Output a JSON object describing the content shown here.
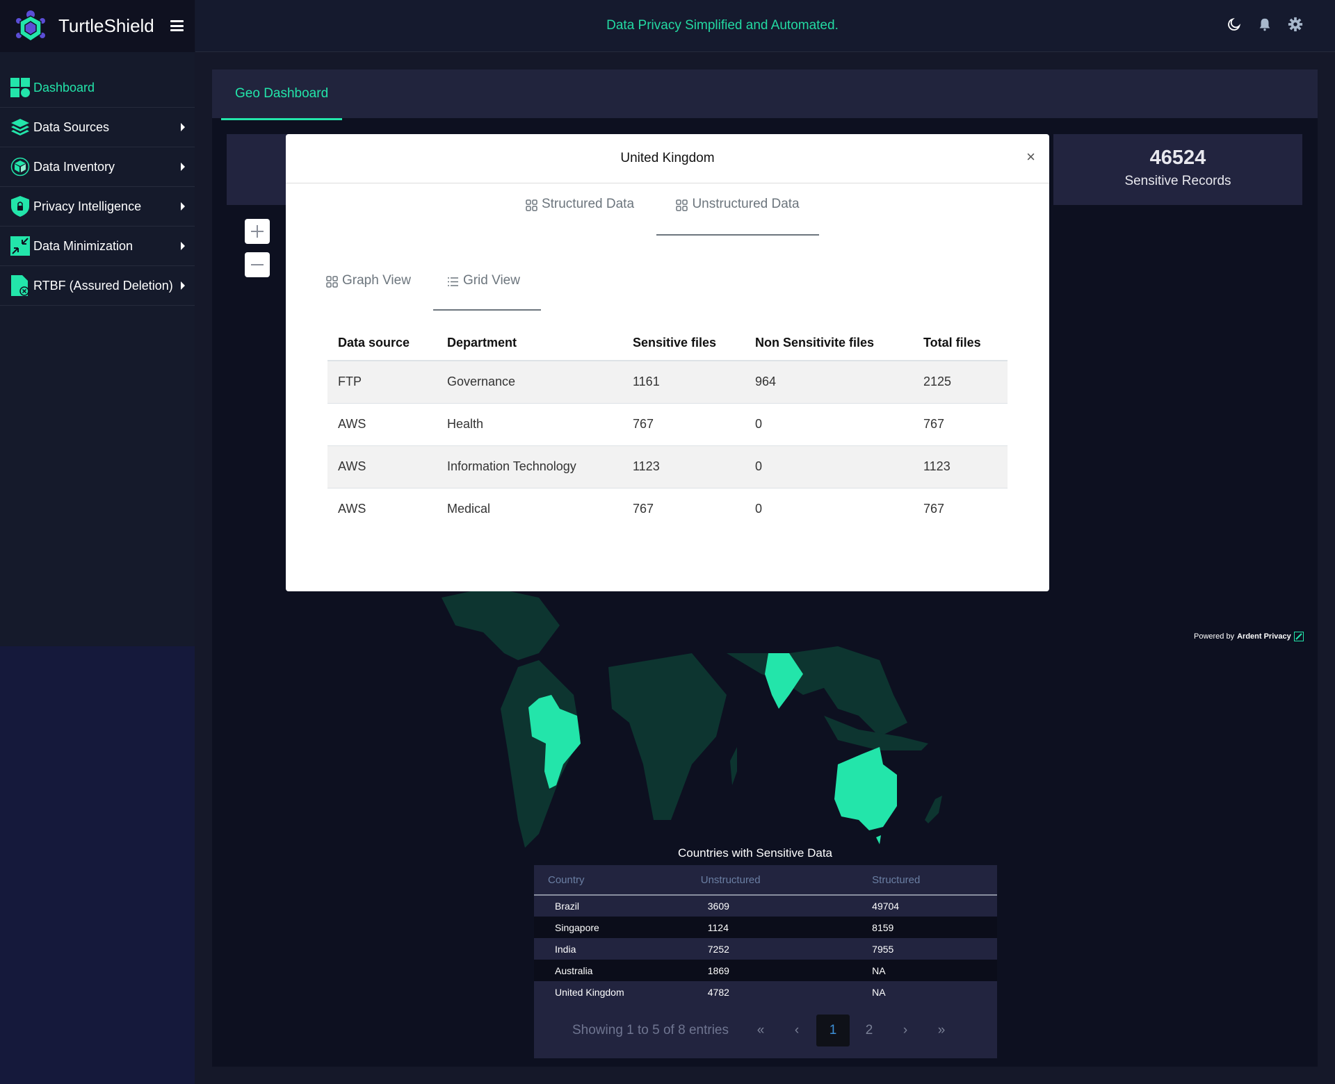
{
  "brand": {
    "name": "TurtleShield"
  },
  "header": {
    "tagline": "Data Privacy Simplified and Automated.",
    "icons": [
      "moon-icon",
      "bell-icon",
      "gear-icon"
    ]
  },
  "sidebar": {
    "items": [
      {
        "label": "Dashboard",
        "icon": "dashboard-icon",
        "active": true
      },
      {
        "label": "Data Sources",
        "icon": "layers-icon"
      },
      {
        "label": "Data Inventory",
        "icon": "inventory-box-icon"
      },
      {
        "label": "Privacy Intelligence",
        "icon": "shield-lock-icon"
      },
      {
        "label": "Data Minimization",
        "icon": "minimize-arrows-icon"
      },
      {
        "label": "RTBF (Assured Deletion)",
        "icon": "file-delete-icon"
      }
    ]
  },
  "page": {
    "tab": "Geo Dashboard",
    "stats": {
      "value": "46524",
      "label": "Sensitive Records"
    },
    "powered_by": {
      "prefix": "Powered by",
      "brand": "Ardent Privacy"
    },
    "colors": {
      "accent": "#23e5aa",
      "highlighted_country": "#23e5aa",
      "other_country": "#0d3530"
    }
  },
  "countries_table": {
    "title": "Countries with Sensitive Data",
    "columns": [
      "Country",
      "Unstructured",
      "Structured"
    ],
    "rows": [
      [
        "Brazil",
        "3609",
        "49704"
      ],
      [
        "Singapore",
        "1124",
        "8159"
      ],
      [
        "India",
        "7252",
        "7955"
      ],
      [
        "Australia",
        "1869",
        "NA"
      ],
      [
        "United Kingdom",
        "4782",
        "NA"
      ]
    ],
    "pagination": {
      "info": "Showing 1 to 5 of 8 entries",
      "first": "«",
      "prev": "‹",
      "pages": [
        "1",
        "2"
      ],
      "current": "1",
      "next": "›",
      "last": "»"
    }
  },
  "modal": {
    "title": "United Kingdom",
    "close": "×",
    "type_tabs": [
      {
        "label": "Structured Data",
        "active": false
      },
      {
        "label": "Unstructured Data",
        "active": true
      }
    ],
    "view_tabs": [
      {
        "label": "Graph View",
        "active": false
      },
      {
        "label": "Grid View",
        "active": true
      }
    ],
    "table": {
      "columns": [
        "Data source",
        "Department",
        "Sensitive files",
        "Non Sensitivite files",
        "Total files"
      ],
      "rows": [
        [
          "FTP",
          "Governance",
          "1161",
          "964",
          "2125"
        ],
        [
          "AWS",
          "Health",
          "767",
          "0",
          "767"
        ],
        [
          "AWS",
          "Information Technology",
          "1123",
          "0",
          "1123"
        ],
        [
          "AWS",
          "Medical",
          "767",
          "0",
          "767"
        ]
      ]
    }
  }
}
